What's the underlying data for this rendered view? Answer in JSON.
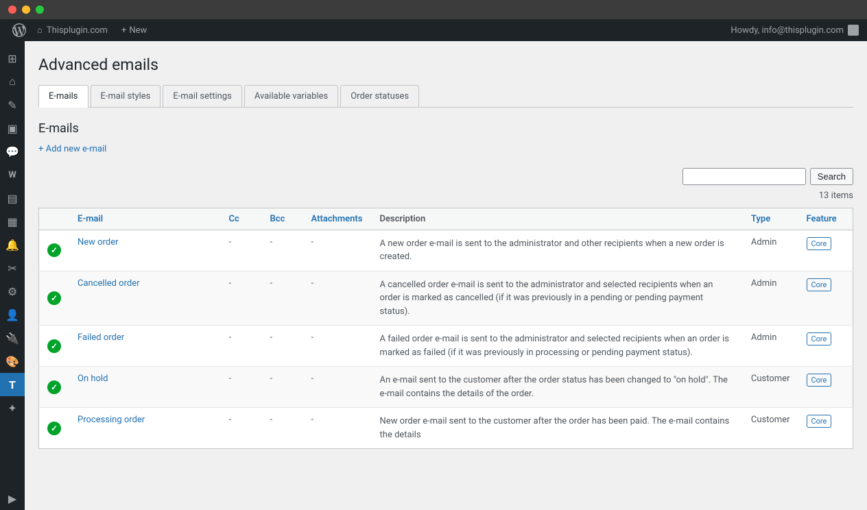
{
  "window": {
    "title": "Advanced emails"
  },
  "admin_bar": {
    "site_name": "Thisplugin.com",
    "new_label": "New",
    "howdy_text": "Howdy, info@thisplugin.com"
  },
  "page": {
    "title": "Advanced emails"
  },
  "tabs": [
    {
      "id": "emails",
      "label": "E-mails",
      "active": true
    },
    {
      "id": "email-styles",
      "label": "E-mail styles",
      "active": false
    },
    {
      "id": "email-settings",
      "label": "E-mail settings",
      "active": false
    },
    {
      "id": "available-variables",
      "label": "Available variables",
      "active": false
    },
    {
      "id": "order-statuses",
      "label": "Order statuses",
      "active": false
    }
  ],
  "section": {
    "title": "E-mails",
    "add_link": "+ Add new e-mail"
  },
  "search": {
    "placeholder": "",
    "button_label": "Search",
    "items_count": "13 items"
  },
  "table": {
    "columns": [
      {
        "id": "status",
        "label": ""
      },
      {
        "id": "email",
        "label": "E-mail"
      },
      {
        "id": "cc",
        "label": "Cc"
      },
      {
        "id": "bcc",
        "label": "Bcc"
      },
      {
        "id": "attachments",
        "label": "Attachments"
      },
      {
        "id": "description",
        "label": "Description"
      },
      {
        "id": "type",
        "label": "Type"
      },
      {
        "id": "feature",
        "label": "Feature"
      }
    ],
    "rows": [
      {
        "status": "active",
        "email": "New order",
        "cc": "-",
        "bcc": "-",
        "attachments": "-",
        "description": "A new order e-mail is sent to the administrator and other recipients when a new order is created.",
        "type": "Admin",
        "feature": "Core"
      },
      {
        "status": "active",
        "email": "Cancelled order",
        "cc": "-",
        "bcc": "-",
        "attachments": "-",
        "description": "A cancelled order e-mail is sent to the administrator and selected recipients when an order is marked as cancelled (if it was previously in a pending or pending payment status).",
        "type": "Admin",
        "feature": "Core"
      },
      {
        "status": "active",
        "email": "Failed order",
        "cc": "-",
        "bcc": "-",
        "attachments": "-",
        "description": "A failed order e-mail is sent to the administrator and selected recipients when an order is marked as failed (if it was previously in processing or pending payment status).",
        "type": "Admin",
        "feature": "Core"
      },
      {
        "status": "active",
        "email": "On hold",
        "cc": "-",
        "bcc": "-",
        "attachments": "-",
        "description": "An e-mail sent to the customer after the order status has been changed to \"on hold\". The e-mail contains the details of the order.",
        "type": "Customer",
        "feature": "Core"
      },
      {
        "status": "active",
        "email": "Processing order",
        "cc": "-",
        "bcc": "-",
        "attachments": "-",
        "description": "New order e-mail sent to the customer after the order has been paid. The e-mail contains the details",
        "type": "Customer",
        "feature": "Core"
      }
    ]
  },
  "sidebar": {
    "items": [
      {
        "id": "wp-logo",
        "icon": "⊞",
        "label": "WordPress"
      },
      {
        "id": "dashboard",
        "icon": "⌂",
        "label": "Dashboard"
      },
      {
        "id": "posts",
        "icon": "✎",
        "label": "Posts"
      },
      {
        "id": "media",
        "icon": "▣",
        "label": "Media"
      },
      {
        "id": "comments",
        "icon": "💬",
        "label": "Comments"
      },
      {
        "id": "woocommerce",
        "icon": "W",
        "label": "WooCommerce"
      },
      {
        "id": "pages",
        "icon": "▤",
        "label": "Pages"
      },
      {
        "id": "analytics",
        "icon": "▦",
        "label": "Analytics"
      },
      {
        "id": "notifications",
        "icon": "🔔",
        "label": "Notifications"
      },
      {
        "id": "tools",
        "icon": "✂",
        "label": "Tools"
      },
      {
        "id": "settings",
        "icon": "⚙",
        "label": "Settings"
      },
      {
        "id": "users",
        "icon": "👤",
        "label": "Users"
      },
      {
        "id": "plugins",
        "icon": "🔌",
        "label": "Plugins"
      },
      {
        "id": "appearance",
        "icon": "🎨",
        "label": "Appearance"
      },
      {
        "id": "advanced-emails",
        "icon": "T",
        "label": "Advanced Emails",
        "active": true
      },
      {
        "id": "extra1",
        "icon": "✦",
        "label": "Extra"
      },
      {
        "id": "collapse",
        "icon": "▶",
        "label": "Collapse"
      }
    ]
  }
}
